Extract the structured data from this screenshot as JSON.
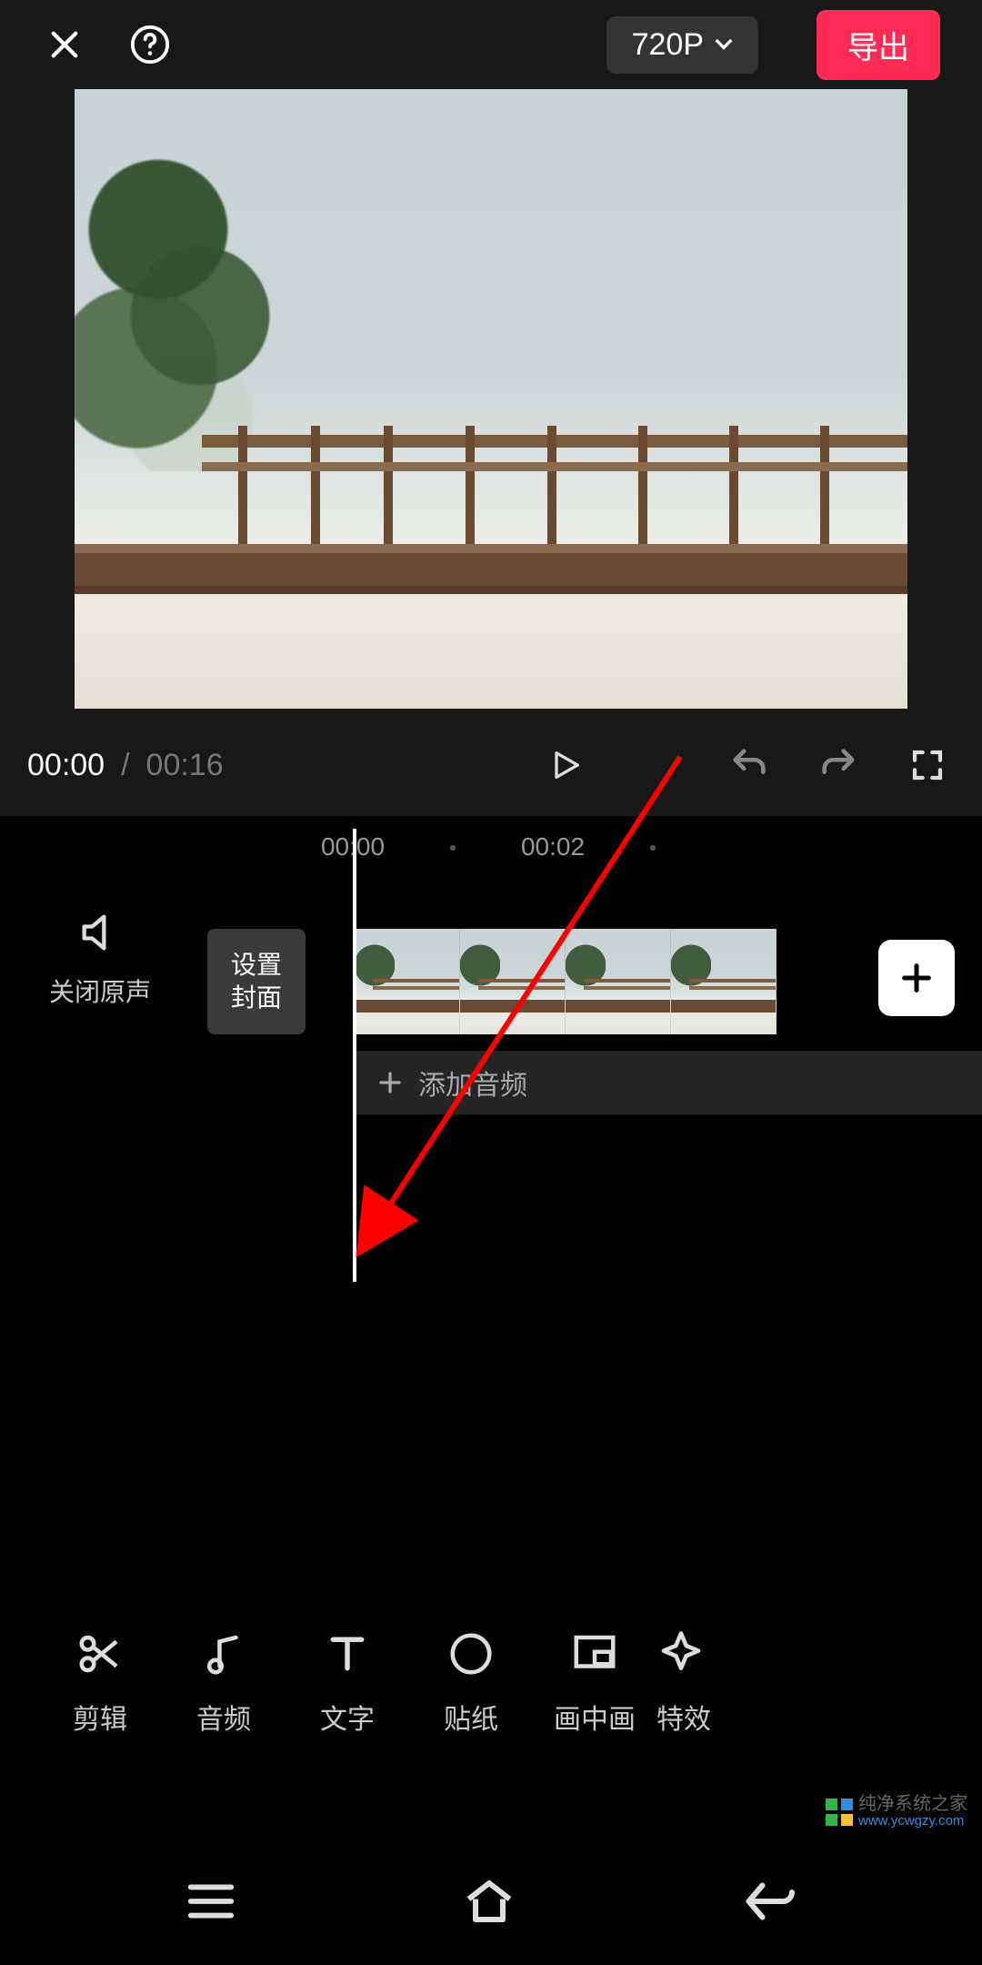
{
  "header": {
    "resolution_label": "720P",
    "export_label": "导出"
  },
  "controls": {
    "current_time": "00:00",
    "total_time": "00:16",
    "separator": "/"
  },
  "timeline": {
    "ticks": [
      "00:00",
      "00:02"
    ],
    "mute_label": "关闭原声",
    "cover_label": "设置\n封面",
    "add_audio_label": "添加音频"
  },
  "toolbar": {
    "items": [
      {
        "id": "cut",
        "label": "剪辑"
      },
      {
        "id": "audio",
        "label": "音频"
      },
      {
        "id": "text",
        "label": "文字"
      },
      {
        "id": "sticker",
        "label": "贴纸"
      },
      {
        "id": "pip",
        "label": "画中画"
      },
      {
        "id": "effect",
        "label": "特效"
      }
    ]
  },
  "watermark": {
    "line1": "纯净系统之家",
    "line2": "www.ycwgzy.com"
  }
}
